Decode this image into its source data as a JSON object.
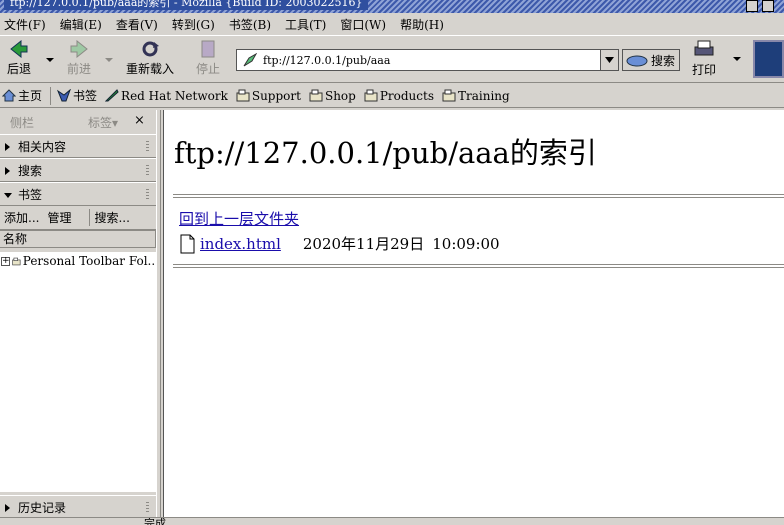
{
  "window": {
    "title": "ftp://127.0.0.1/pub/aaa的索引 - Mozilla {Build ID: 2003022516}"
  },
  "menu": [
    "文件(F)",
    "编辑(E)",
    "查看(V)",
    "转到(G)",
    "书签(B)",
    "工具(T)",
    "窗口(W)",
    "帮助(H)"
  ],
  "nav": {
    "back": "后退",
    "forward": "前进",
    "reload": "重新载入",
    "stop": "停止",
    "search": "搜索",
    "print": "打印"
  },
  "url": {
    "value": "ftp://127.0.0.1/pub/aaa"
  },
  "bookmarks_bar": [
    "主页",
    "书签",
    "Red Hat Network",
    "Support",
    "Shop",
    "Products",
    "Training"
  ],
  "sidebar": {
    "title": "侧栏",
    "tabs_label": "标签▾",
    "close": "×",
    "sections": {
      "related": "相关内容",
      "search": "搜索",
      "bookmarks": "书签",
      "history": "历史记录"
    },
    "tools": {
      "add": "添加...",
      "manage": "管理",
      "search": "搜索..."
    },
    "column_header": "名称",
    "tree_items": [
      "Personal Toolbar Fol..."
    ]
  },
  "page": {
    "heading": "ftp://127.0.0.1/pub/aaa的索引",
    "up_link": "回到上一层文件夹",
    "files": [
      {
        "name": "index.html",
        "date": "2020年11月29日",
        "time": "10:09:00"
      }
    ]
  },
  "status": {
    "text": "完成"
  },
  "colors": {
    "link": "#1a0dab",
    "chrome": "#d6d3ce",
    "titlebar": "#3d59ab"
  }
}
